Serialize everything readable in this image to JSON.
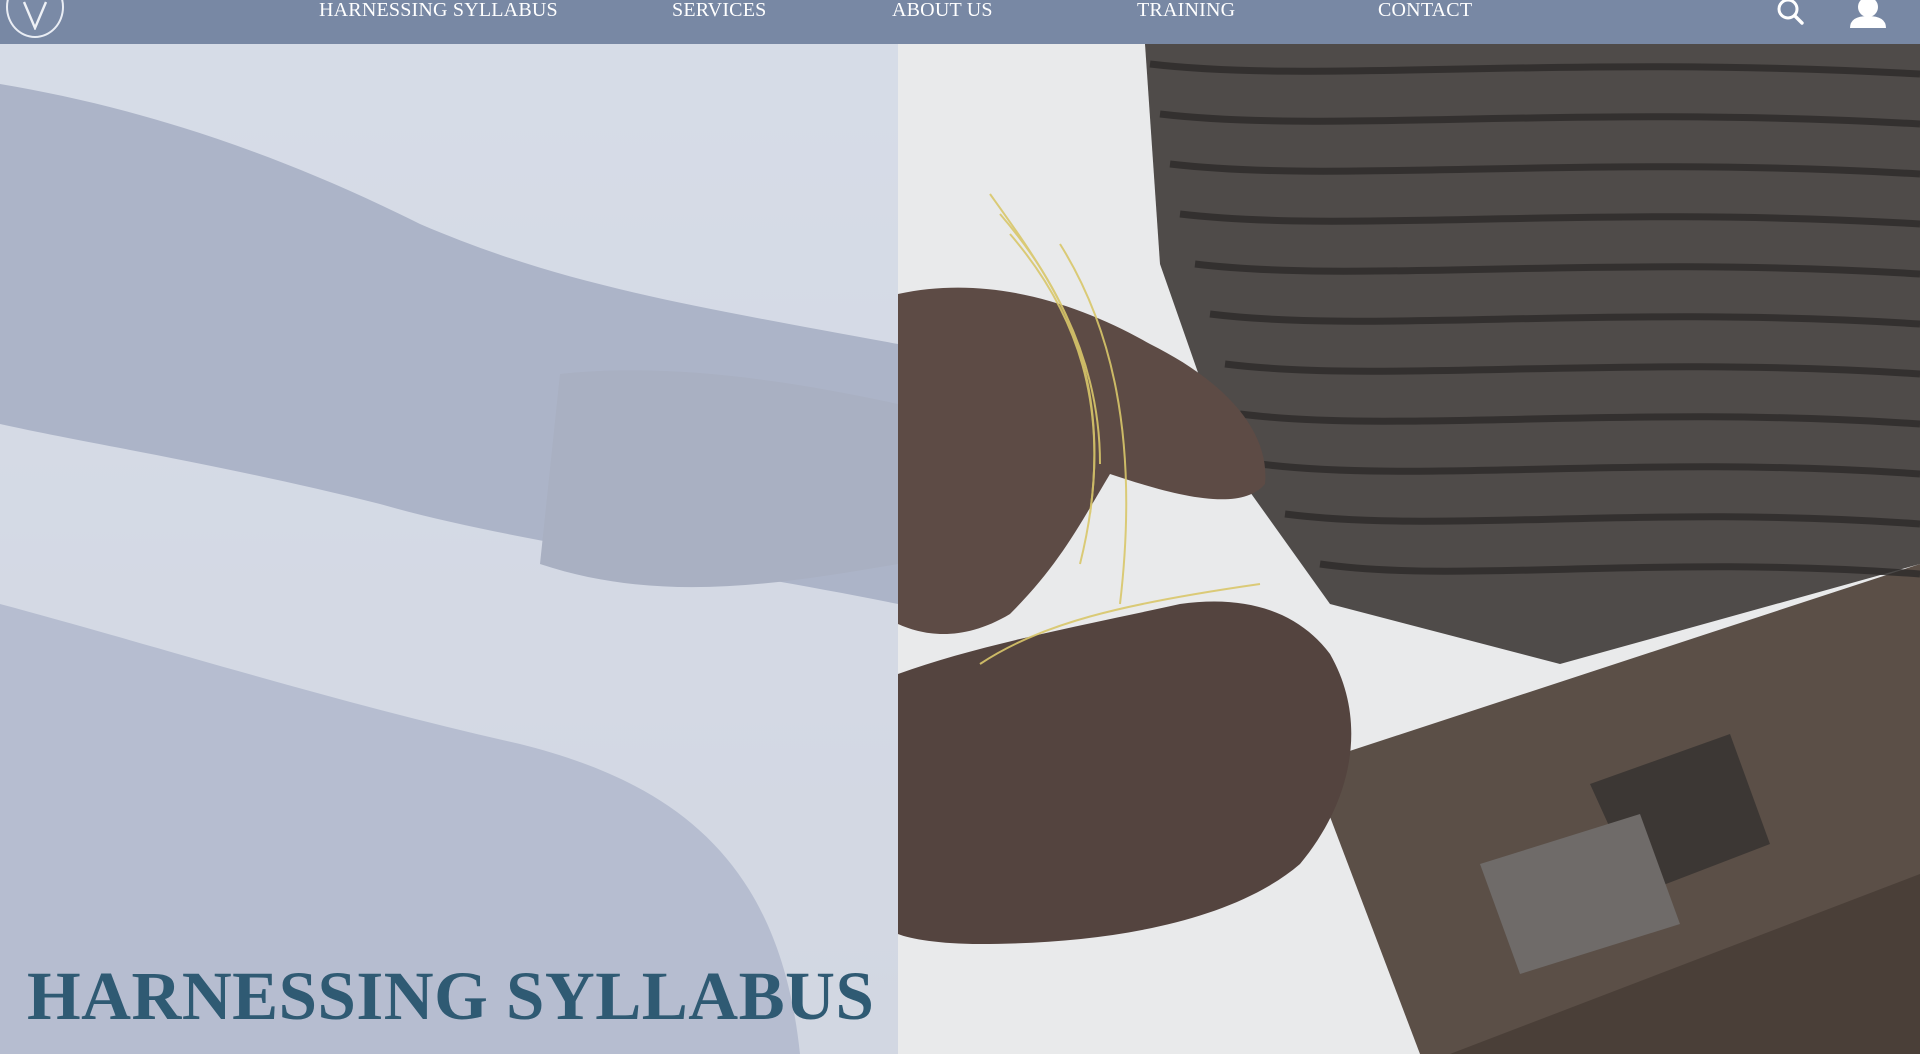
{
  "nav": {
    "logo_letter": "V",
    "links": [
      {
        "label": "HARNESSING SYLLABUS"
      },
      {
        "label": "SERVICES"
      },
      {
        "label": "ABOUT US"
      },
      {
        "label": "TRAINING"
      },
      {
        "label": "CONTACT"
      }
    ],
    "icons": [
      "search-icon",
      "user-icon"
    ]
  },
  "hero": {
    "title": "HARNESSING SYLLABUS",
    "overlay_color": "#ced5e4",
    "title_color": "#2f5a73"
  },
  "colors": {
    "navbar": "#7888a4",
    "nav_text": "#ffffff"
  }
}
